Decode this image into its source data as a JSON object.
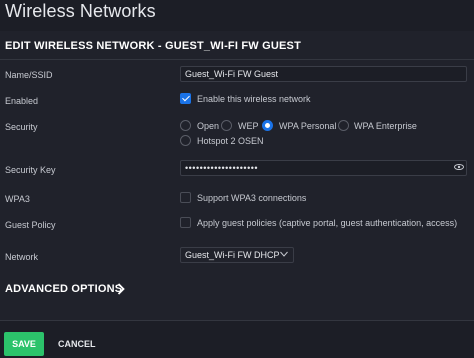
{
  "page": {
    "title": "Wireless Networks"
  },
  "panel": {
    "header": "EDIT WIRELESS NETWORK - GUEST_WI-FI FW GUEST"
  },
  "fields": {
    "name_label": "Name/SSID",
    "name_value": "Guest_Wi-Fi FW Guest",
    "enabled_label": "Enabled",
    "enabled_text": "Enable this wireless network",
    "enabled_checked": true,
    "security_label": "Security",
    "security_options": [
      "Open",
      "WEP",
      "WPA Personal",
      "WPA Enterprise",
      "Hotspot 2 OSEN"
    ],
    "security_selected": "WPA Personal",
    "security_key_label": "Security Key",
    "security_key_value": "••••••••••••••••••••",
    "wpa3_label": "WPA3",
    "wpa3_text": "Support WPA3 connections",
    "guest_policy_label": "Guest Policy",
    "guest_policy_text": "Apply guest policies (captive portal, guest authentication, access)",
    "network_label": "Network",
    "network_value": "Guest_Wi-Fi FW DHCP"
  },
  "advanced": {
    "label": "ADVANCED OPTIONS"
  },
  "footer": {
    "save_label": "SAVE",
    "cancel_label": "CANCEL"
  },
  "colors": {
    "accent": "#1a73e8",
    "save": "#2cc36b",
    "background": "#1c1e26"
  }
}
